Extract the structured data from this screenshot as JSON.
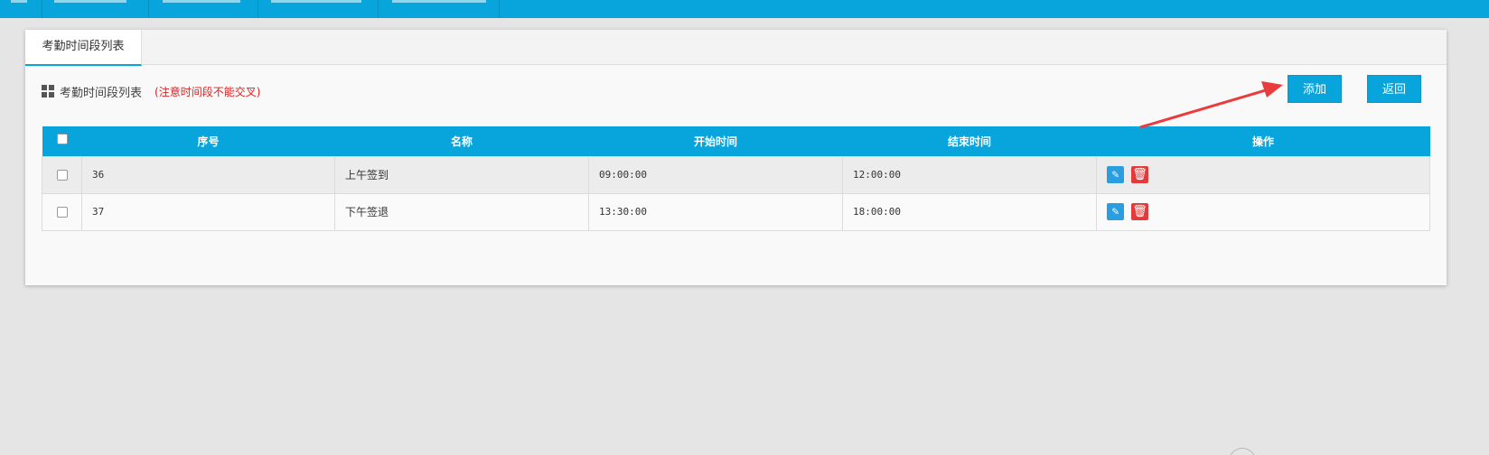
{
  "tabs": [
    {
      "label": "考勤时间段列表"
    }
  ],
  "section": {
    "title": "考勤时间段列表",
    "note": "(注意时间段不能交叉)",
    "icon": "grid-icon"
  },
  "toolbar": {
    "add_label": "添加",
    "back_label": "返回"
  },
  "table": {
    "columns": [
      "序号",
      "名称",
      "开始时间",
      "结束时间",
      "操作"
    ],
    "rows": [
      {
        "id": "36",
        "name": "上午签到",
        "start": "09:00:00",
        "end": "12:00:00",
        "actions": [
          "edit-icon",
          "delete-icon"
        ]
      },
      {
        "id": "37",
        "name": "下午签退",
        "start": "13:30:00",
        "end": "18:00:00",
        "actions": [
          "edit-icon",
          "delete-icon"
        ]
      }
    ]
  },
  "colors": {
    "accent": "#07a5dc",
    "note": "#e02020",
    "delete": "#e23b3b",
    "annotation_arrow": "#ea3c3c",
    "background": "#e5e5e5"
  }
}
